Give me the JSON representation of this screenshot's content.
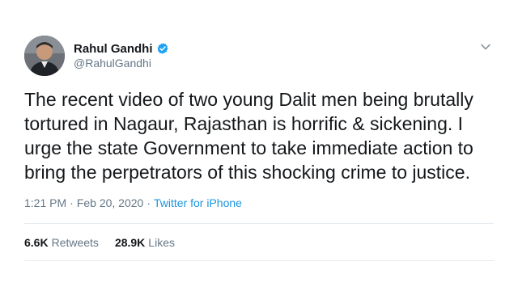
{
  "author": {
    "display_name": "Rahul Gandhi",
    "handle": "@RahulGandhi",
    "verified_icon": "verified-badge-icon",
    "avatar_icon": "avatar"
  },
  "tweet": {
    "text": "The recent video of two young Dalit men being brutally\ntortured in Nagaur, Rajasthan is horrific & sickening. I\nurge the state Government to take immediate action to\nbring the perpetrators of this shocking crime to justice."
  },
  "meta": {
    "time": "1:21 PM",
    "separator": "·",
    "date": "Feb 20, 2020",
    "source": "Twitter for iPhone"
  },
  "stats": {
    "retweets_count": "6.6K",
    "retweets_label": "Retweets",
    "likes_count": "28.9K",
    "likes_label": "Likes"
  },
  "colors": {
    "text": "#14171a",
    "secondary": "#657786",
    "link": "#1b95e0",
    "verified": "#1da1f2",
    "divider": "#e6ecf0"
  }
}
